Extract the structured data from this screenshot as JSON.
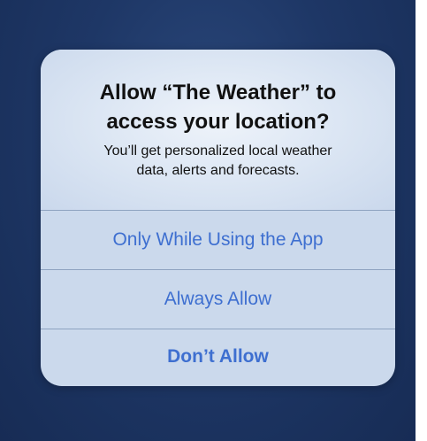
{
  "alert": {
    "title_line1": "Allow “The Weather” to",
    "title_line2": "access your location?",
    "message_line1": "You’ll get personalized local weather",
    "message_line2": "data, alerts and forecasts."
  },
  "buttons": {
    "only_while_using": "Only While Using the App",
    "always_allow": "Always Allow",
    "dont_allow": "Don’t Allow"
  },
  "colors": {
    "background": "#1e3766",
    "alert_background": "#dde7f4",
    "button_text": "#3e6fd0",
    "divider": "#8ea3c0"
  }
}
